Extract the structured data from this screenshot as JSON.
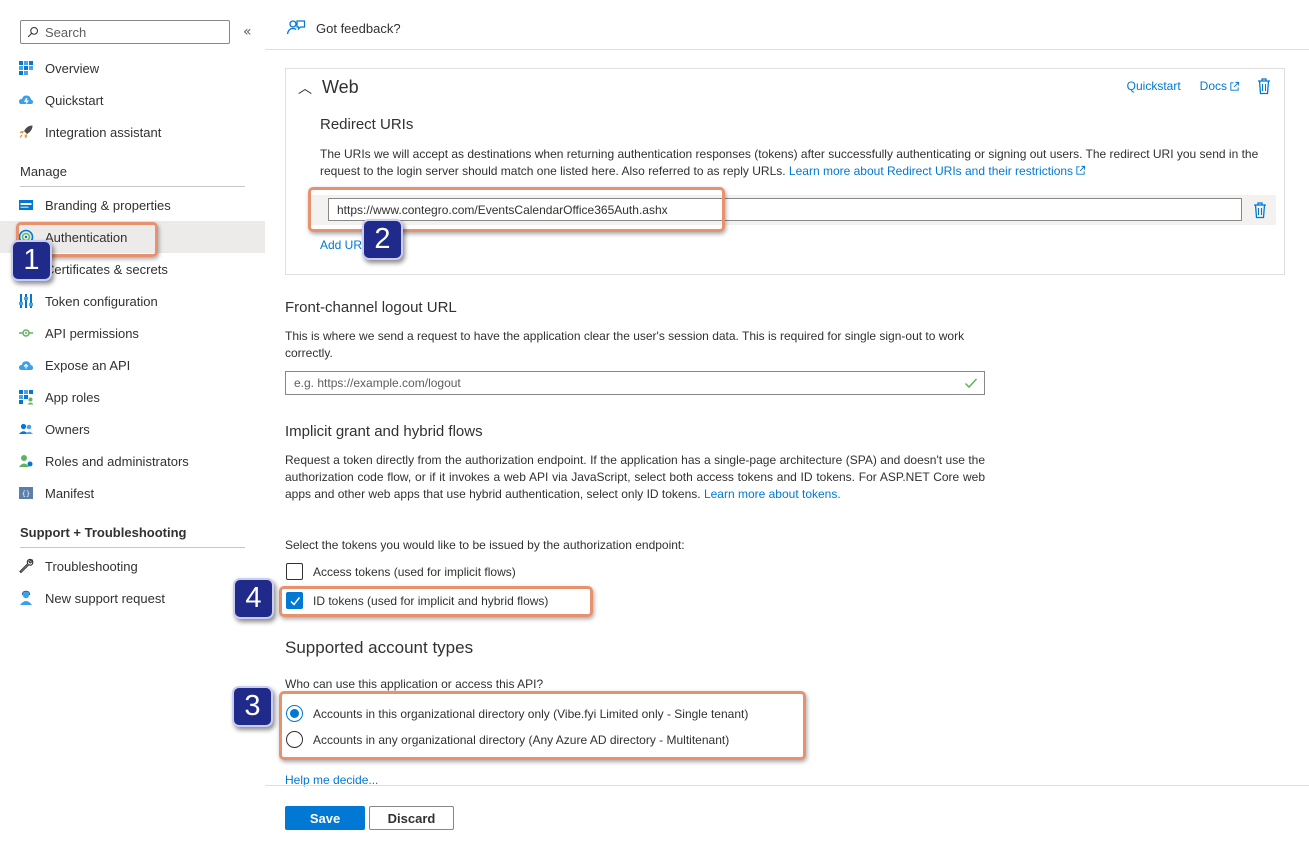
{
  "sidebar": {
    "search_placeholder": "Search",
    "collapse_glyph": "«",
    "items_top": [
      {
        "label": "Overview",
        "icon": "overview-icon"
      },
      {
        "label": "Quickstart",
        "icon": "quickstart-icon"
      },
      {
        "label": "Integration assistant",
        "icon": "rocket-icon"
      }
    ],
    "manage_title": "Manage",
    "manage_items": [
      {
        "label": "Branding & properties",
        "icon": "branding-icon"
      },
      {
        "label": "Authentication",
        "icon": "authentication-icon",
        "active": true
      },
      {
        "label": "Certificates & secrets",
        "icon": "key-icon"
      },
      {
        "label": "Token configuration",
        "icon": "token-icon"
      },
      {
        "label": "API permissions",
        "icon": "api-permissions-icon"
      },
      {
        "label": "Expose an API",
        "icon": "cloud-icon"
      },
      {
        "label": "App roles",
        "icon": "app-roles-icon"
      },
      {
        "label": "Owners",
        "icon": "owners-icon"
      },
      {
        "label": "Roles and administrators",
        "icon": "roles-icon"
      },
      {
        "label": "Manifest",
        "icon": "manifest-icon"
      }
    ],
    "support_title": "Support + Troubleshooting",
    "support_items": [
      {
        "label": "Troubleshooting",
        "icon": "wrench-icon"
      },
      {
        "label": "New support request",
        "icon": "support-person-icon"
      }
    ]
  },
  "topbar": {
    "feedback_label": "Got feedback?"
  },
  "web": {
    "title": "Web",
    "quickstart_link": "Quickstart",
    "docs_link": "Docs",
    "redirect_title": "Redirect URIs",
    "redirect_desc": "The URIs we will accept as destinations when returning authentication responses (tokens) after successfully authenticating or signing out users. The redirect URI you send in the request to the login server should match one listed here. Also referred to as reply URLs.",
    "redirect_learn_link": "Learn more about Redirect URIs and their restrictions",
    "uri_value": "https://www.contegro.com/EventsCalendarOffice365Auth.ashx",
    "add_uri_link": "Add URI"
  },
  "front_channel": {
    "title": "Front-channel logout URL",
    "desc": "This is where we send a request to have the application clear the user's session data. This is required for single sign-out to work correctly.",
    "placeholder": "e.g. https://example.com/logout"
  },
  "implicit": {
    "title": "Implicit grant and hybrid flows",
    "desc": "Request a token directly from the authorization endpoint. If the application has a single-page architecture (SPA) and doesn't use the authorization code flow, or if it invokes a web API via JavaScript, select both access tokens and ID tokens. For ASP.NET Core web apps and other web apps that use hybrid authentication, select only ID tokens.",
    "learn_link": "Learn more about tokens.",
    "select_prompt": "Select the tokens you would like to be issued by the authorization endpoint:",
    "access_tokens": {
      "label": "Access tokens (used for implicit flows)",
      "checked": false
    },
    "id_tokens": {
      "label": "ID tokens (used for implicit and hybrid flows)",
      "checked": true
    }
  },
  "account_types": {
    "title": "Supported account types",
    "question": "Who can use this application or access this API?",
    "options": [
      {
        "label": "Accounts in this organizational directory only (Vibe.fyi Limited only - Single tenant)",
        "selected": true
      },
      {
        "label": "Accounts in any organizational directory (Any Azure AD directory - Multitenant)",
        "selected": false
      }
    ],
    "help_link": "Help me decide..."
  },
  "footer": {
    "save_label": "Save",
    "discard_label": "Discard"
  },
  "annotations": [
    "1",
    "2",
    "3",
    "4"
  ],
  "colors": {
    "accent": "#0078d4",
    "highlight": "#e8916f",
    "badge": "#1f2a8a"
  }
}
